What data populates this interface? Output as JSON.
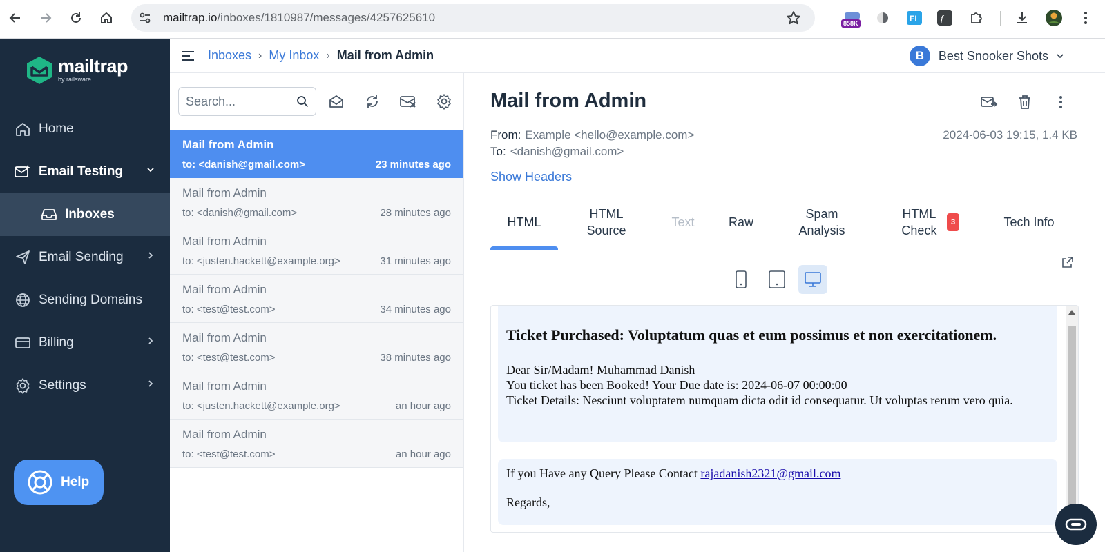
{
  "browser": {
    "url_host": "mailtrap.io",
    "url_path": "/inboxes/1810987/messages/4257625610",
    "extension_badge": "858K"
  },
  "sidebar": {
    "logo": {
      "name": "mailtrap",
      "tagline": "by railsware"
    },
    "items": [
      {
        "label": "Home",
        "icon": "home-icon"
      },
      {
        "label": "Email Testing",
        "icon": "email-testing-icon"
      },
      {
        "label": "Inboxes",
        "icon": "inbox-icon"
      },
      {
        "label": "Email Sending",
        "icon": "send-icon"
      },
      {
        "label": "Sending Domains",
        "icon": "globe-icon"
      },
      {
        "label": "Billing",
        "icon": "card-icon"
      },
      {
        "label": "Settings",
        "icon": "gear-icon"
      }
    ],
    "help_label": "Help"
  },
  "topbar": {
    "breadcrumbs": [
      "Inboxes",
      "My Inbox",
      "Mail from Admin"
    ],
    "account_initial": "B",
    "account_name": "Best Snooker Shots"
  },
  "list": {
    "search_placeholder": "Search...",
    "messages": [
      {
        "subject": "Mail from Admin",
        "to": "to: <danish@gmail.com>",
        "time": "23 minutes ago",
        "active": true
      },
      {
        "subject": "Mail from Admin",
        "to": "to: <danish@gmail.com>",
        "time": "28 minutes ago"
      },
      {
        "subject": "Mail from Admin",
        "to": "to: <justen.hackett@example.org>",
        "time": "31 minutes ago"
      },
      {
        "subject": "Mail from Admin",
        "to": "to: <test@test.com>",
        "time": "34 minutes ago"
      },
      {
        "subject": "Mail from Admin",
        "to": "to: <test@test.com>",
        "time": "38 minutes ago"
      },
      {
        "subject": "Mail from Admin",
        "to": "to: <justen.hackett@example.org>",
        "time": "an hour ago"
      },
      {
        "subject": "Mail from Admin",
        "to": "to: <test@test.com>",
        "time": "an hour ago"
      }
    ]
  },
  "message": {
    "title": "Mail from Admin",
    "from_label": "From:",
    "from_value": "Example <hello@example.com>",
    "to_label": "To:",
    "to_value": "<danish@gmail.com>",
    "meta": "2024-06-03 19:15, 1.4 KB",
    "show_headers": "Show Headers",
    "tabs": [
      {
        "label": "HTML"
      },
      {
        "label": "HTML Source"
      },
      {
        "label": "Text"
      },
      {
        "label": "Raw"
      },
      {
        "label": "Spam Analysis"
      },
      {
        "label": "HTML Check",
        "badge": "3"
      },
      {
        "label": "Tech Info"
      }
    ],
    "body": {
      "heading": "Ticket Purchased: Voluptatum quas et eum possimus et non exercitationem.",
      "greeting": "Dear Sir/Madam! Muhammad Danish",
      "line1": "You ticket has been Booked! Your Due date is: 2024-06-07 00:00:00",
      "line2": "Ticket Details: Nesciunt voluptatem numquam dicta odit id consequatur. Ut voluptas rerum vero quia.",
      "contact_text": "If you Have any Query Please Contact ",
      "contact_email": "rajadanish2321@gmail.com",
      "regards": "Regards,"
    }
  },
  "colors": {
    "sidebar_bg": "#1b2c3f",
    "accent": "#4e8ef0",
    "link": "#3a79d8",
    "badge": "#ef4b4b"
  }
}
